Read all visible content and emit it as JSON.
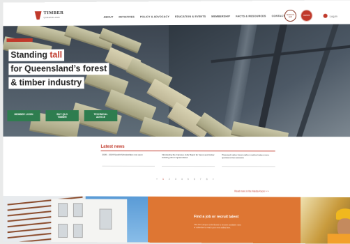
{
  "header": {
    "logo_title": "TIMBER",
    "logo_subtitle": "QUEENSLAND",
    "nav": [
      "ABOUT",
      "INITIATIVES",
      "POLICY & ADVOCACY",
      "EDUCATION & EVENTS",
      "MEMBERSHIP",
      "FACTS & RESOURCES",
      "CONTACT"
    ],
    "badge1": "MADE IN QLD",
    "badge2": "AWARD",
    "login_label": "Log in"
  },
  "hero": {
    "line1_pre": "Standing ",
    "line1_accent": "tall",
    "line2": "for Queensland’s forest",
    "line3": "& timber industry",
    "buttons": [
      "MEMBER LOGIN",
      "BUY QLD TIMBER",
      "TECHNICAL ADVICE"
    ]
  },
  "news": {
    "title": "Latest news",
    "items": [
      "2020 – 2024 Seedlit Scholarships now open",
      "Introducing the Campus Jobs Board for forest and timber industry jobs in Queensland",
      "Proposed native forest carbon method raises more questions than answers"
    ],
    "pages": [
      "«",
      "1",
      "2",
      "3",
      "4",
      "5",
      "6",
      "7",
      "8",
      "»"
    ],
    "read_more": "Read more in the Media Room » »"
  },
  "promo": {
    "heading": "Find a job or recruit talent",
    "body": "Visit the Campus Jobs Board to browse available roles or advertise to reach your next skilled hire."
  },
  "colors": {
    "accent_red": "#c0392b",
    "button_green": "#2e7d4f",
    "promo_orange": "#de7633"
  }
}
